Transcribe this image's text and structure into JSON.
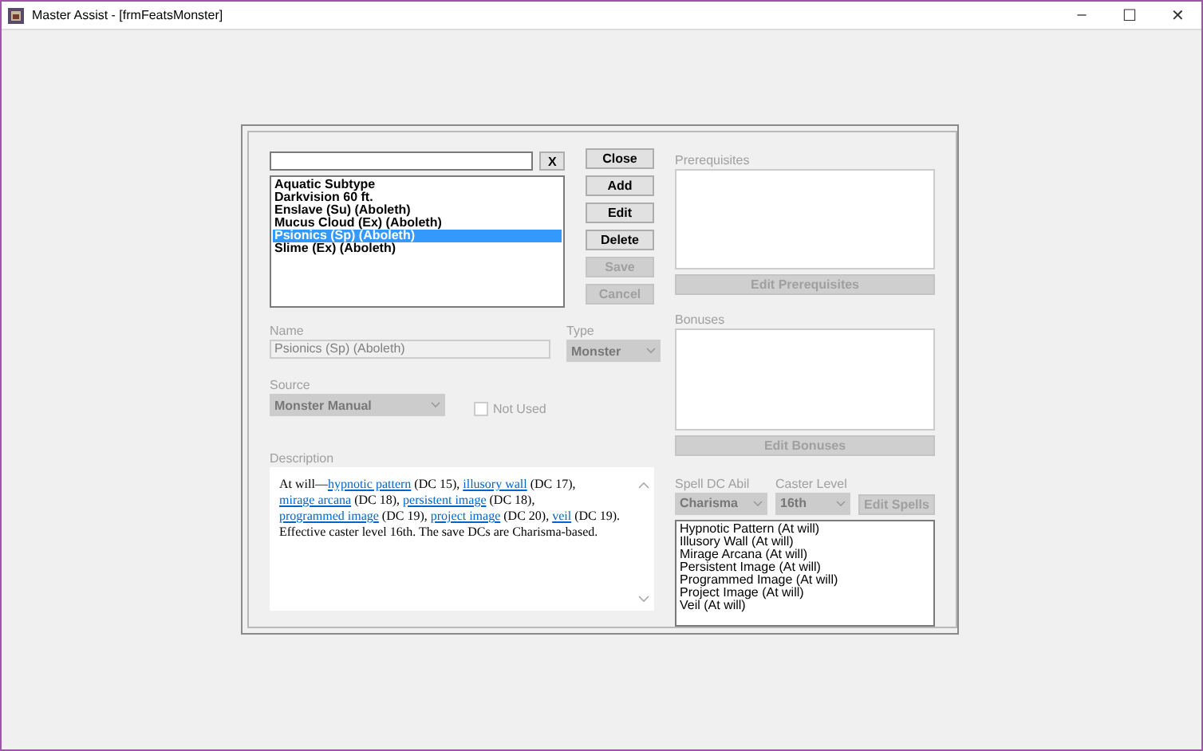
{
  "window": {
    "title": "Master Assist - [frmFeatsMonster]",
    "controls": [
      "–",
      "☐",
      "✕"
    ]
  },
  "search": {
    "clear_label": "X"
  },
  "feats": [
    {
      "label": "Aquatic Subtype",
      "selected": false
    },
    {
      "label": "Darkvision 60 ft.",
      "selected": false
    },
    {
      "label": "Enslave (Su) (Aboleth)",
      "selected": false
    },
    {
      "label": "Mucus Cloud (Ex) (Aboleth)",
      "selected": false
    },
    {
      "label": "Psionics (Sp) (Aboleth)",
      "selected": true
    },
    {
      "label": "Slime (Ex) (Aboleth)",
      "selected": false
    }
  ],
  "buttons": [
    {
      "label": "Close",
      "disabled": false
    },
    {
      "label": "Add",
      "disabled": false
    },
    {
      "label": "Edit",
      "disabled": false
    },
    {
      "label": "Delete",
      "disabled": false
    },
    {
      "label": "Save",
      "disabled": true
    },
    {
      "label": "Cancel",
      "disabled": true
    }
  ],
  "name": {
    "label": "Name",
    "value": "Psionics (Sp) (Aboleth)",
    "disabled": true
  },
  "type": {
    "label": "Type",
    "value": "Monster",
    "disabled": true
  },
  "source": {
    "label": "Source",
    "value": "Monster Manual",
    "disabled": true
  },
  "not_used": {
    "label": "Not Used",
    "checked": false,
    "disabled": true
  },
  "description": {
    "label": "Description",
    "segments": [
      {
        "kind": "text",
        "text": "At will—"
      },
      {
        "kind": "link",
        "text": "hypnotic pattern"
      },
      {
        "kind": "text",
        "text": " (DC 15), "
      },
      {
        "kind": "link",
        "text": "illusory wall"
      },
      {
        "kind": "text",
        "text": " (DC 17), "
      },
      {
        "kind": "link",
        "text": "mirage arcana"
      },
      {
        "kind": "text",
        "text": " (DC 18), "
      },
      {
        "kind": "link",
        "text": "persistent image"
      },
      {
        "kind": "text",
        "text": " (DC 18), "
      },
      {
        "kind": "link",
        "text": "programmed image"
      },
      {
        "kind": "text",
        "text": " (DC 19), "
      },
      {
        "kind": "link",
        "text": "project image"
      },
      {
        "kind": "text",
        "text": " (DC 20), "
      },
      {
        "kind": "link",
        "text": "veil"
      },
      {
        "kind": "text",
        "text": " (DC 19). Effective caster level 16th. The save DCs are Charisma-based."
      }
    ]
  },
  "prerequisites": {
    "label": "Prerequisites",
    "button": "Edit Prerequisites",
    "disabled": true
  },
  "bonuses": {
    "label": "Bonuses",
    "button": "Edit Bonuses",
    "disabled": true
  },
  "spell_dc_abil": {
    "label": "Spell DC Abil",
    "value": "Charisma",
    "disabled": true
  },
  "caster_level": {
    "label": "Caster Level",
    "value": "16th",
    "disabled": true
  },
  "edit_spells": {
    "label": "Edit Spells",
    "disabled": true
  },
  "spells": [
    "Hypnotic Pattern (At will)",
    "Illusory Wall (At will)",
    "Mirage Arcana (At will)",
    "Persistent Image (At will)",
    "Programmed Image (At will)",
    "Project Image (At will)",
    "Veil (At will)"
  ]
}
